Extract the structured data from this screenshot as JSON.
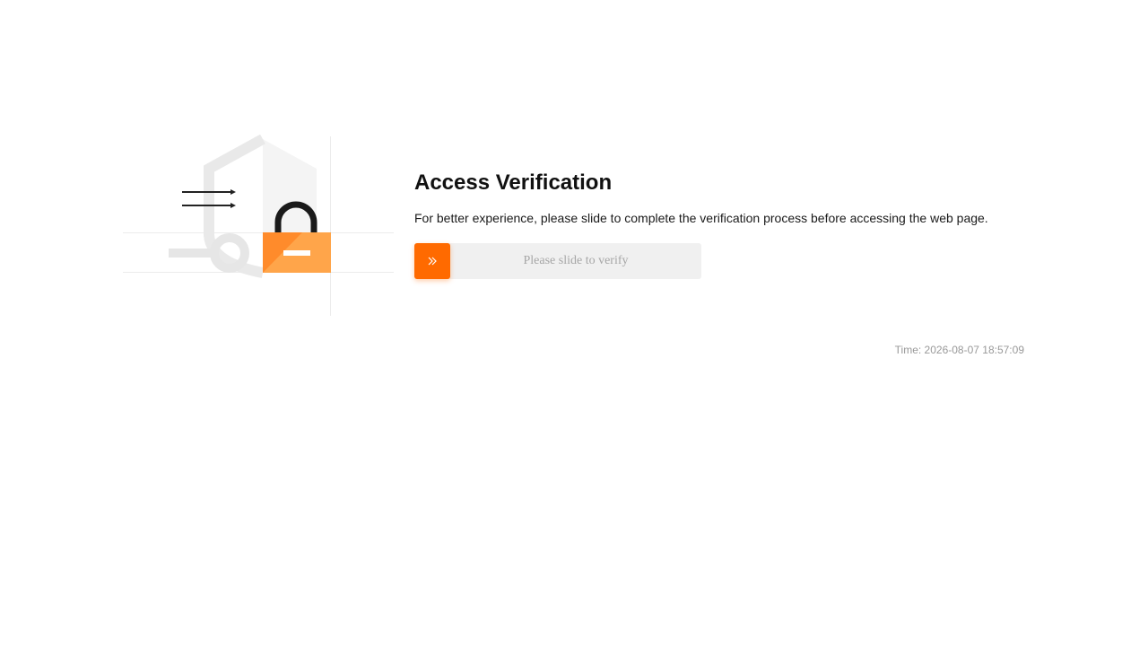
{
  "verification": {
    "title": "Access Verification",
    "description": "For better experience, please slide to complete the verification process before accessing the web page.",
    "slider_text": "Please slide to verify",
    "slider_icon": "double-chevron-right-icon",
    "time": "Time: 2026-08-07 18:57:09"
  },
  "colors": {
    "accent": "#ff6a00",
    "accent_light": "#ffa54a",
    "slider_track": "#f0f0f0",
    "muted_text": "#999999"
  },
  "illustration": {
    "icons": [
      "shield-icon",
      "padlock-icon",
      "arrows-icon",
      "key-icon"
    ]
  }
}
